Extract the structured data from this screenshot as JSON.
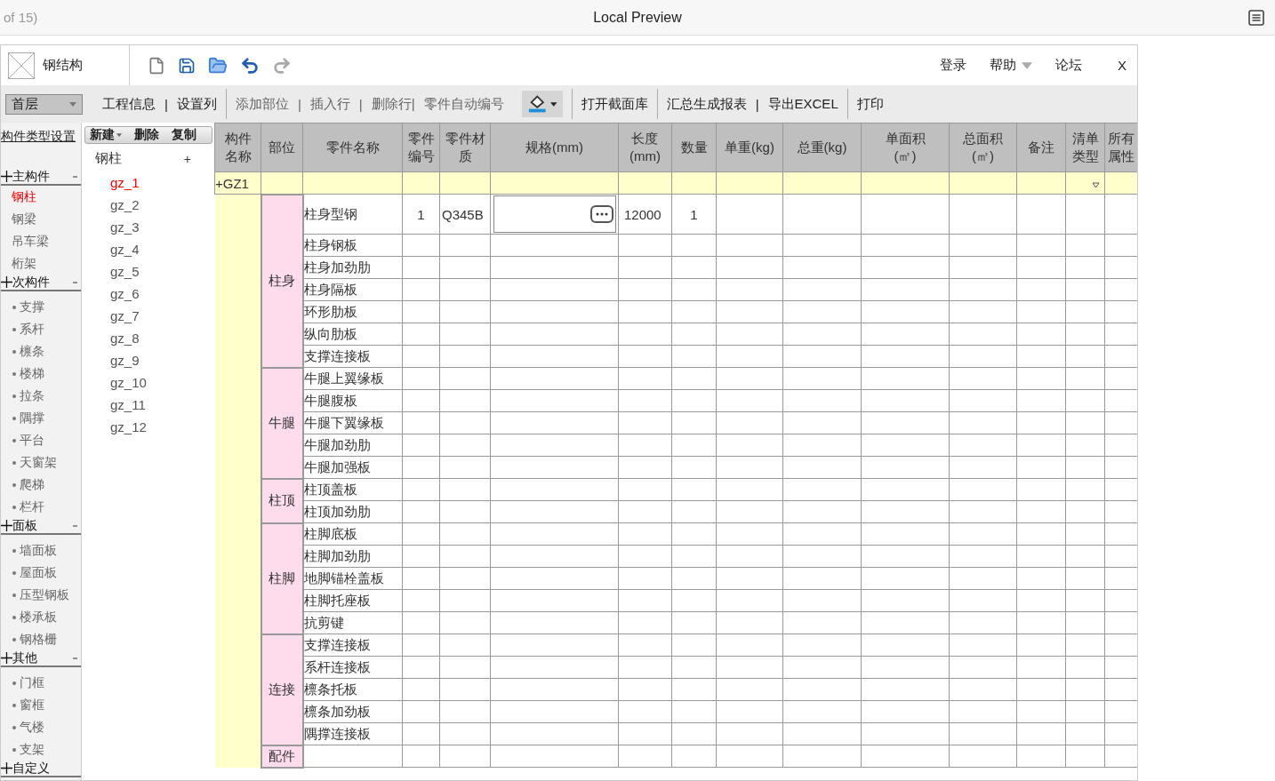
{
  "browser_bar": {
    "page_info": "of 15)",
    "title": "Local Preview"
  },
  "app": {
    "title": "钢结构",
    "links": [
      {
        "label": "登录",
        "menu": false
      },
      {
        "label": "帮助",
        "menu": true
      },
      {
        "label": "论坛",
        "menu": false
      }
    ],
    "close": "X"
  },
  "toolbar": {
    "groups": [
      [
        {
          "kind": "select",
          "label": "首层",
          "disabled": false
        },
        {
          "kind": "button",
          "label": "工程信息",
          "disabled": false
        },
        {
          "kind": "pipe",
          "label": "|",
          "disabled": false
        },
        {
          "kind": "button",
          "label": "设置列",
          "disabled": false
        }
      ],
      [
        {
          "kind": "button",
          "label": "添加部位",
          "disabled": true
        },
        {
          "kind": "pipe",
          "label": "|",
          "disabled": true
        },
        {
          "kind": "button",
          "label": "插入行",
          "disabled": true
        },
        {
          "kind": "pipe",
          "label": "|",
          "disabled": true
        },
        {
          "kind": "button",
          "label": "删除行|",
          "disabled": true
        },
        {
          "kind": "button",
          "label": "零件自动编号",
          "disabled": true
        },
        {
          "kind": "paint",
          "disabled": false
        }
      ],
      [
        {
          "kind": "button",
          "label": "打开截面库",
          "disabled": false
        }
      ],
      [
        {
          "kind": "button",
          "label": "汇总生成报表",
          "disabled": false
        },
        {
          "kind": "pipe",
          "label": "|",
          "disabled": false
        },
        {
          "kind": "button",
          "label": "导出EXCEL",
          "disabled": false
        }
      ],
      [
        {
          "kind": "button",
          "label": "打印",
          "disabled": false
        }
      ]
    ]
  },
  "sidebar": {
    "title": "构件类型设置",
    "sections": [
      {
        "title": "主构件",
        "expanded": true,
        "kind": "plain",
        "items": [
          {
            "label": "钢柱",
            "selected": true
          },
          {
            "label": "钢梁",
            "selected": false
          },
          {
            "label": "吊车梁",
            "selected": false
          },
          {
            "label": "桁架",
            "selected": false
          }
        ]
      },
      {
        "title": "次构件",
        "expanded": true,
        "kind": "bulleted",
        "items": [
          {
            "label": "支撑",
            "selected": false
          },
          {
            "label": "系杆",
            "selected": false
          },
          {
            "label": "檩条",
            "selected": false
          },
          {
            "label": "楼梯",
            "selected": false
          },
          {
            "label": "拉条",
            "selected": false
          },
          {
            "label": "隅撑",
            "selected": false
          },
          {
            "label": "平台",
            "selected": false
          },
          {
            "label": "天窗架",
            "selected": false
          },
          {
            "label": "爬梯",
            "selected": false
          },
          {
            "label": "栏杆",
            "selected": false
          }
        ]
      },
      {
        "title": "面板",
        "expanded": true,
        "kind": "bulleted",
        "items": [
          {
            "label": "墙面板",
            "selected": false
          },
          {
            "label": "屋面板",
            "selected": false
          },
          {
            "label": "压型钢板",
            "selected": false
          },
          {
            "label": "楼承板",
            "selected": false
          },
          {
            "label": "钢格栅",
            "selected": false
          }
        ]
      },
      {
        "title": "其他",
        "expanded": true,
        "kind": "bulleted",
        "items": [
          {
            "label": "门框",
            "selected": false
          },
          {
            "label": "窗框",
            "selected": false
          },
          {
            "label": "气楼",
            "selected": false
          },
          {
            "label": "支架",
            "selected": false
          }
        ]
      },
      {
        "title": "自定义",
        "expanded": false
      }
    ]
  },
  "component_list": {
    "actions": [
      {
        "label": "新建",
        "menu": true
      },
      {
        "label": "删除",
        "menu": false
      },
      {
        "label": "复制",
        "menu": false
      }
    ],
    "type": "钢柱",
    "add": "+",
    "items": [
      {
        "label": "gz_1",
        "selected": true
      },
      {
        "label": "gz_2",
        "selected": false
      },
      {
        "label": "gz_3",
        "selected": false
      },
      {
        "label": "gz_4",
        "selected": false
      },
      {
        "label": "gz_5",
        "selected": false
      },
      {
        "label": "gz_6",
        "selected": false
      },
      {
        "label": "gz_7",
        "selected": false
      },
      {
        "label": "gz_8",
        "selected": false
      },
      {
        "label": "gz_9",
        "selected": false
      },
      {
        "label": "gz_10",
        "selected": false
      },
      {
        "label": "gz_11",
        "selected": false
      },
      {
        "label": "gz_12",
        "selected": false
      }
    ]
  },
  "table": {
    "columns": [
      "构件名称",
      "部位",
      "零件名称",
      "零件编号",
      "零件材质",
      "规格(mm)",
      "长度\n(mm)",
      "数量",
      "单重(kg)",
      "总重(kg)",
      "单面积\n(㎡)",
      "总面积\n(㎡)",
      "备注",
      "清单类型",
      "所有属性"
    ],
    "groups": [
      {
        "name": "+GZ1",
        "parts": [
          {
            "name": "柱身",
            "rows": [
              {
                "name": "柱身型钢",
                "number": "1",
                "material": "Q345B",
                "length": "12000",
                "quantity": "1",
                "editing": true
              },
              {
                "name": "柱身钢板",
                "editing": false
              },
              {
                "name": "柱身加劲肋",
                "editing": false
              },
              {
                "name": "柱身隔板",
                "editing": false
              },
              {
                "name": "环形肋板",
                "editing": false
              },
              {
                "name": "纵向肋板",
                "editing": false
              },
              {
                "name": "支撑连接板",
                "editing": false
              }
            ]
          },
          {
            "name": "牛腿",
            "rows": [
              {
                "name": "牛腿上翼缘板",
                "editing": false
              },
              {
                "name": "牛腿腹板",
                "editing": false
              },
              {
                "name": "牛腿下翼缘板",
                "editing": false
              },
              {
                "name": "牛腿加劲肋",
                "editing": false
              },
              {
                "name": "牛腿加强板",
                "editing": false
              }
            ]
          },
          {
            "name": "柱顶",
            "rows": [
              {
                "name": "柱顶盖板",
                "editing": false
              },
              {
                "name": "柱顶加劲肋",
                "editing": false
              }
            ]
          },
          {
            "name": "柱脚",
            "rows": [
              {
                "name": "柱脚底板",
                "editing": false
              },
              {
                "name": "柱脚加劲肋",
                "editing": false
              },
              {
                "name": "地脚锚栓盖板",
                "editing": false
              },
              {
                "name": "柱脚托座板",
                "editing": false
              },
              {
                "name": "抗剪键",
                "editing": false
              }
            ]
          },
          {
            "name": "连接",
            "rows": [
              {
                "name": "支撑连接板",
                "editing": false
              },
              {
                "name": "系杆连接板",
                "editing": false
              },
              {
                "name": "檩条托板",
                "editing": false
              },
              {
                "name": "檩条加劲板",
                "editing": false
              },
              {
                "name": "隅撑连接板",
                "editing": false
              }
            ]
          },
          {
            "name": "配件",
            "rows": [
              {
                "editing": false
              }
            ]
          }
        ]
      }
    ]
  }
}
